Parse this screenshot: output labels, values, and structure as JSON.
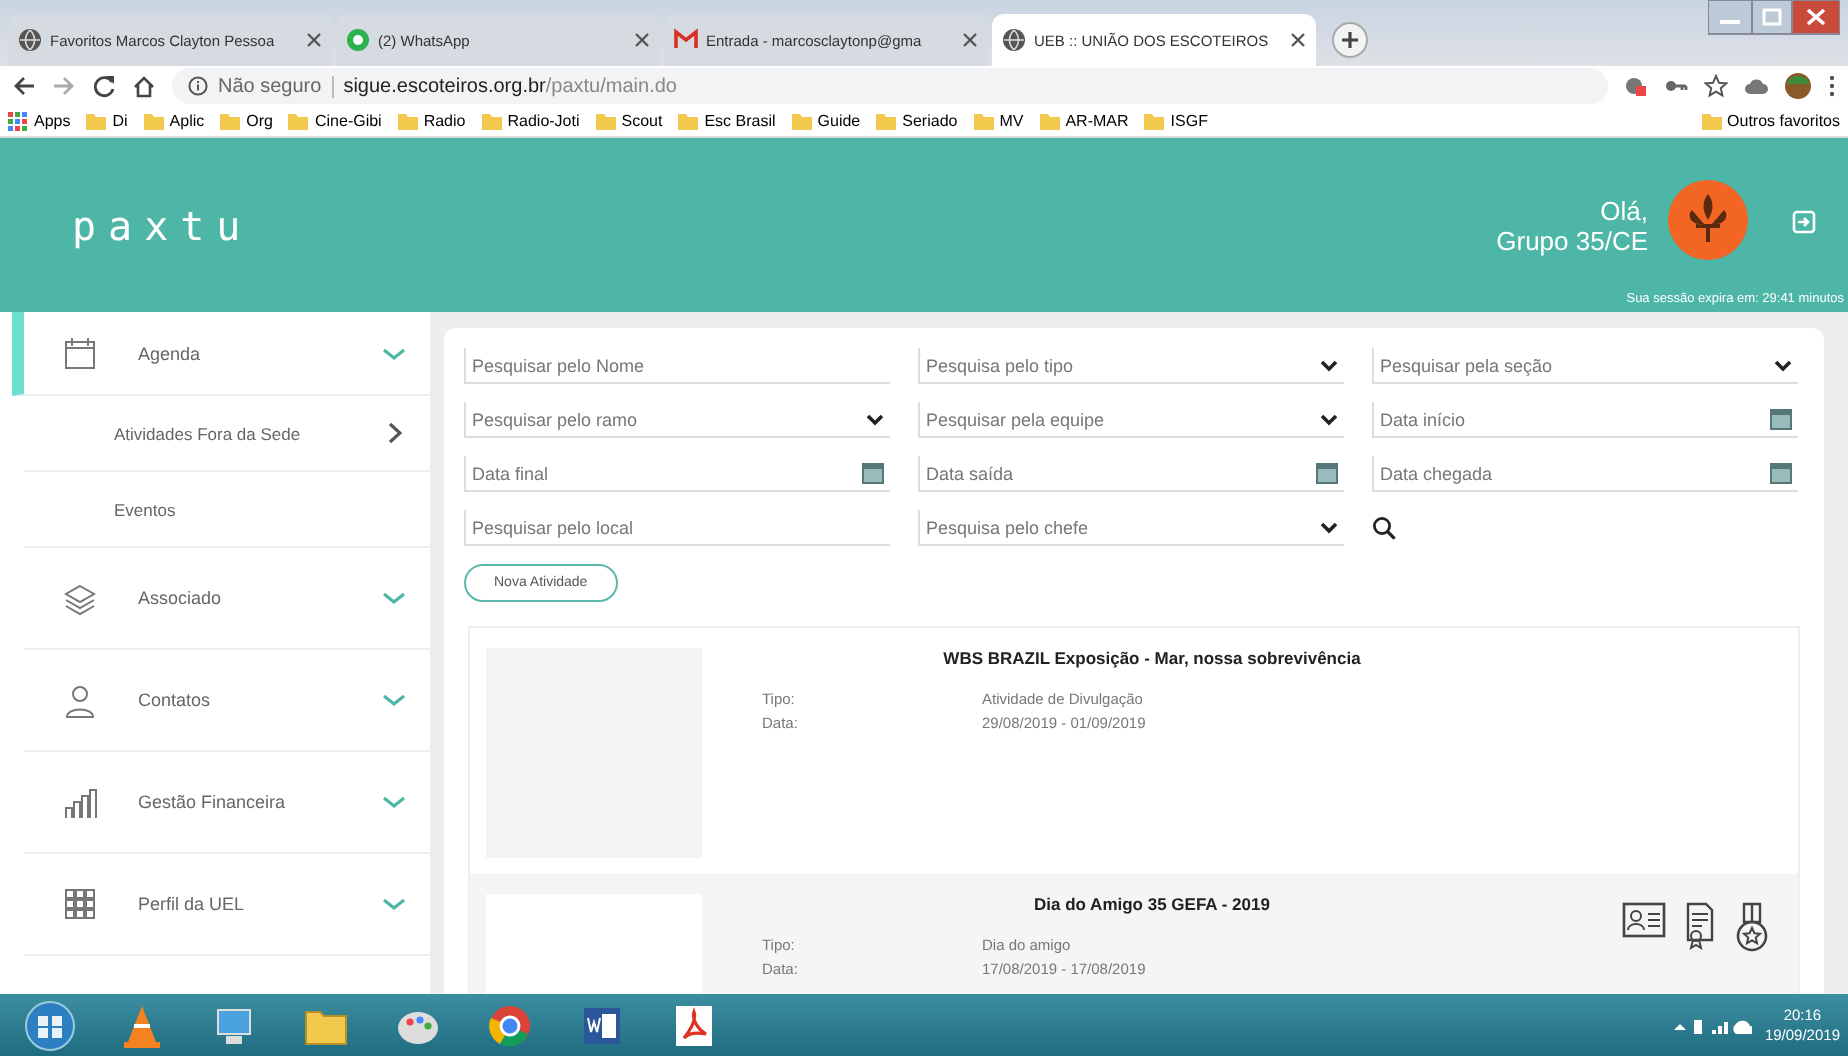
{
  "browser": {
    "tabs": [
      {
        "title": "Favoritos Marcos Clayton Pessoa",
        "selected": false
      },
      {
        "title": "(2) WhatsApp",
        "selected": false
      },
      {
        "title": "Entrada - marcosclaytonp@gma",
        "selected": false
      },
      {
        "title": "UEB :: UNIÃO DOS ESCOTEIROS",
        "selected": true
      }
    ],
    "address": {
      "security": "Não seguro",
      "host": "sigue.escoteiros.org.br",
      "path": "/paxtu/main.do"
    },
    "bookmarks": [
      {
        "label": "Apps",
        "kind": "apps"
      },
      {
        "label": "Di",
        "kind": "folder"
      },
      {
        "label": "Aplic",
        "kind": "folder"
      },
      {
        "label": "Org",
        "kind": "folder"
      },
      {
        "label": "Cine-Gibi",
        "kind": "folder"
      },
      {
        "label": "Radio",
        "kind": "folder"
      },
      {
        "label": "Radio-Joti",
        "kind": "folder"
      },
      {
        "label": "Scout",
        "kind": "folder"
      },
      {
        "label": "Esc Brasil",
        "kind": "folder"
      },
      {
        "label": "Guide",
        "kind": "folder"
      },
      {
        "label": "Seriado",
        "kind": "folder"
      },
      {
        "label": "MV",
        "kind": "folder"
      },
      {
        "label": "AR-MAR",
        "kind": "folder"
      },
      {
        "label": "ISGF",
        "kind": "folder"
      }
    ],
    "other_bookmarks": "Outros favoritos"
  },
  "header": {
    "logo": "paxtu",
    "greeting": "Olá,",
    "user": "Grupo 35/CE",
    "session": "Sua sessão expira em: 29:41 minutos"
  },
  "sidebar": {
    "items": [
      {
        "label": "Agenda",
        "selected": true,
        "children": [
          {
            "label": "Atividades Fora da Sede",
            "has_submenu": true
          },
          {
            "label": "Eventos",
            "has_submenu": false
          }
        ]
      },
      {
        "label": "Associado",
        "selected": false
      },
      {
        "label": "Contatos",
        "selected": false
      },
      {
        "label": "Gestão Financeira",
        "selected": false
      },
      {
        "label": "Perfil da UEL",
        "selected": false
      }
    ]
  },
  "filters": [
    {
      "placeholder": "Pesquisar pelo Nome",
      "kind": "text"
    },
    {
      "placeholder": "Pesquisa pelo tipo",
      "kind": "select"
    },
    {
      "placeholder": "Pesquisar pela seção",
      "kind": "select"
    },
    {
      "placeholder": "Pesquisar pelo ramo",
      "kind": "select"
    },
    {
      "placeholder": "Pesquisar pela equipe",
      "kind": "select"
    },
    {
      "placeholder": "Data início",
      "kind": "date"
    },
    {
      "placeholder": "Data final",
      "kind": "date"
    },
    {
      "placeholder": "Data saída",
      "kind": "date"
    },
    {
      "placeholder": "Data chegada",
      "kind": "date"
    },
    {
      "placeholder": "Pesquisar pelo local",
      "kind": "text"
    },
    {
      "placeholder": "Pesquisa pelo chefe",
      "kind": "select"
    }
  ],
  "new_button": "Nova Atividade",
  "activities": [
    {
      "title": "WBS BRAZIL Exposição - Mar, nossa sobrevivência",
      "type_label": "Tipo:",
      "type": "Atividade de Divulgação",
      "date_label": "Data:",
      "date": "29/08/2019 - 01/09/2019",
      "highlighted": false
    },
    {
      "title": "Dia do Amigo 35 GEFA - 2019",
      "type_label": "Tipo:",
      "type": "Dia do amigo",
      "date_label": "Data:",
      "date": "17/08/2019 - 17/08/2019",
      "highlighted": true
    }
  ],
  "taskbar": {
    "time": "20:16",
    "date": "19/09/2019"
  }
}
